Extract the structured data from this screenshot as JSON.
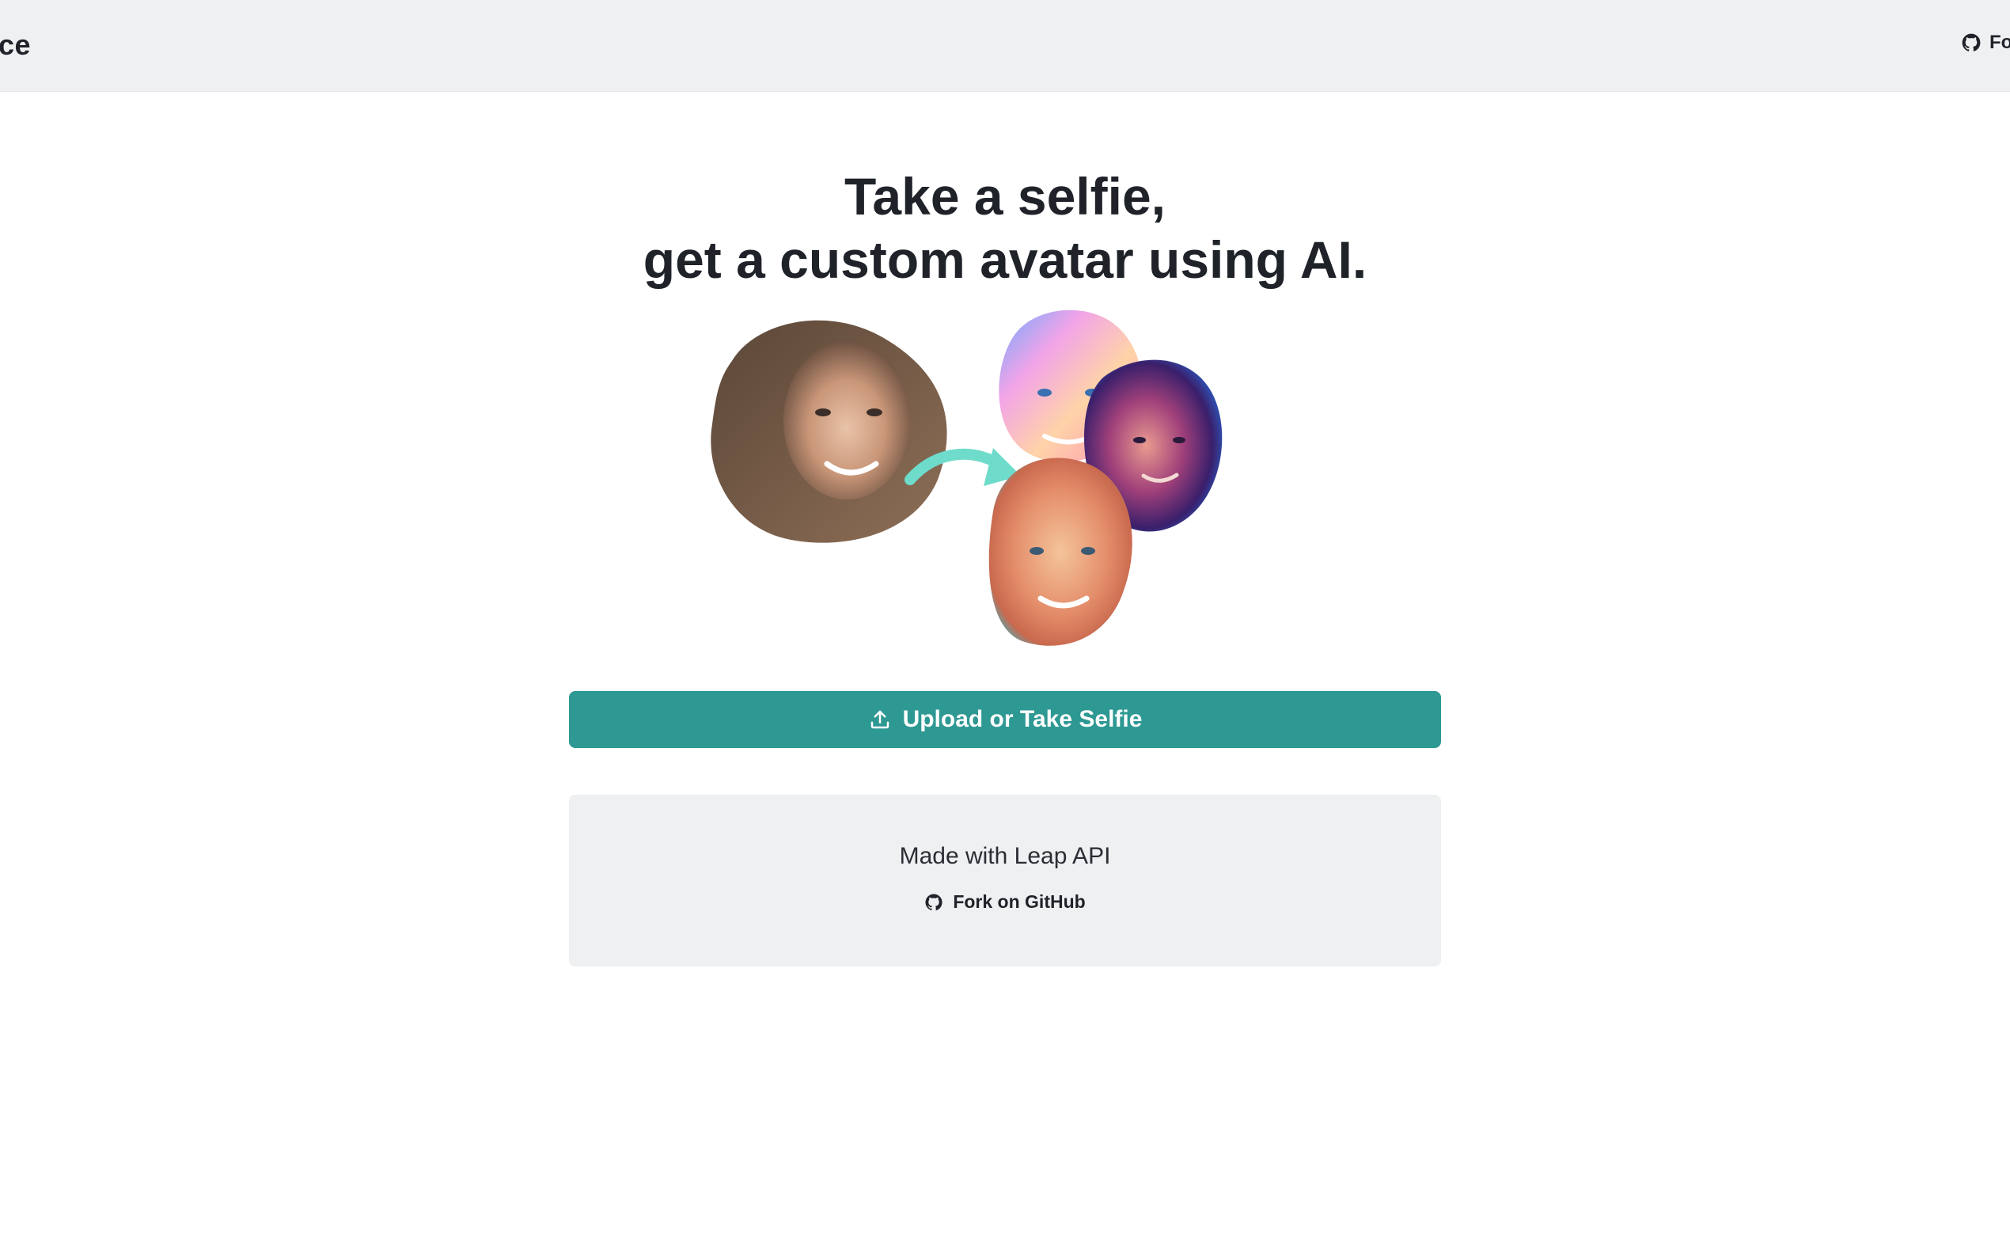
{
  "header": {
    "brand": "ce",
    "fork_label": "Fo",
    "fork_icon": "github-icon"
  },
  "hero": {
    "line1": "Take a selfie,",
    "line2": "get a custom avatar using AI."
  },
  "upload": {
    "label": "Upload or Take Selfie",
    "icon": "upload-icon"
  },
  "footer": {
    "made_with": "Made with Leap API",
    "fork_label": "Fork on GitHub",
    "fork_icon": "github-icon"
  },
  "colors": {
    "accent": "#2e9893",
    "header_bg": "#eff0f2",
    "card_bg": "#eff0f2",
    "text": "#1f2329",
    "arrow": "#6fdccb"
  }
}
